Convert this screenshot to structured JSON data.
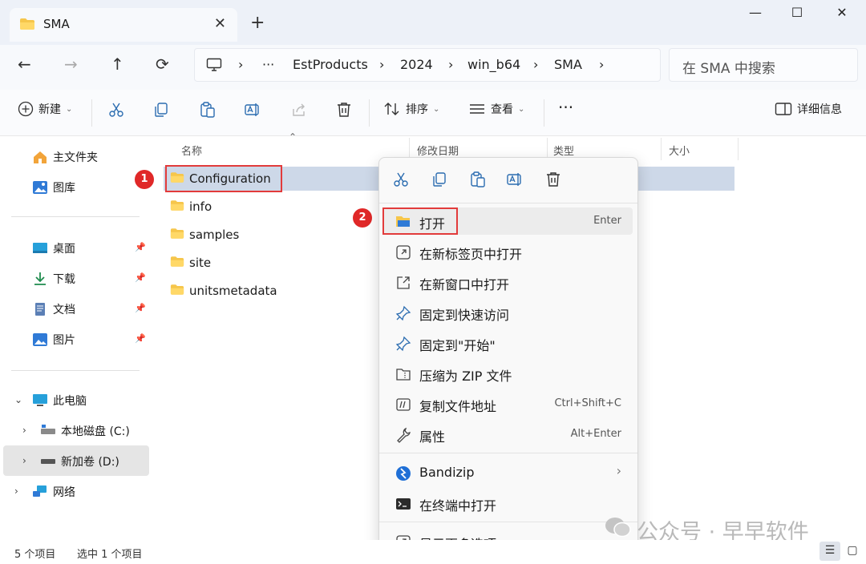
{
  "tab": {
    "title": "SMA",
    "close": "✕"
  },
  "newtab": "+",
  "window": {
    "minimize": "—",
    "maximize": "☐",
    "close": "✕"
  },
  "nav": {
    "back": "←",
    "forward": "→",
    "up": "↑",
    "refresh": "⟳"
  },
  "address": {
    "segments": [
      "EstProducts",
      "2024",
      "win_b64",
      "SMA"
    ],
    "ellipsis": "···",
    "sep": "›"
  },
  "search": {
    "placeholder": "在 SMA 中搜索"
  },
  "toolbar": {
    "new_label": "新建",
    "sort_label": "排序",
    "view_label": "查看",
    "more_label": "···",
    "details_label": "详细信息"
  },
  "sidebar": {
    "home": "主文件夹",
    "gallery": "图库",
    "desktop": "桌面",
    "downloads": "下载",
    "documents": "文档",
    "pictures": "图片",
    "thispc": "此电脑",
    "cdrive": "本地磁盘 (C:)",
    "ddrive": "新加卷 (D:)",
    "network": "网络"
  },
  "columns": {
    "name": "名称",
    "modified": "修改日期",
    "type": "类型",
    "size": "大小"
  },
  "files": [
    "Configuration",
    "info",
    "samples",
    "site",
    "unitsmetadata"
  ],
  "badges": {
    "one": "1",
    "two": "2"
  },
  "context_menu": {
    "open": {
      "label": "打开",
      "key": "Enter"
    },
    "open_new_tab": "在新标签页中打开",
    "open_new_window": "在新窗口中打开",
    "pin_quick": "固定到快速访问",
    "pin_start": "固定到\"开始\"",
    "compress_zip": "压缩为 ZIP 文件",
    "copy_path": {
      "label": "复制文件地址",
      "key": "Ctrl+Shift+C"
    },
    "properties": {
      "label": "属性",
      "key": "Alt+Enter"
    },
    "bandizip": "Bandizip",
    "terminal": "在终端中打开",
    "more_options": "显示更多选项"
  },
  "status": {
    "count": "5 个项目",
    "selected": "选中 1 个项目"
  },
  "watermark": "公众号 · 早早软件"
}
